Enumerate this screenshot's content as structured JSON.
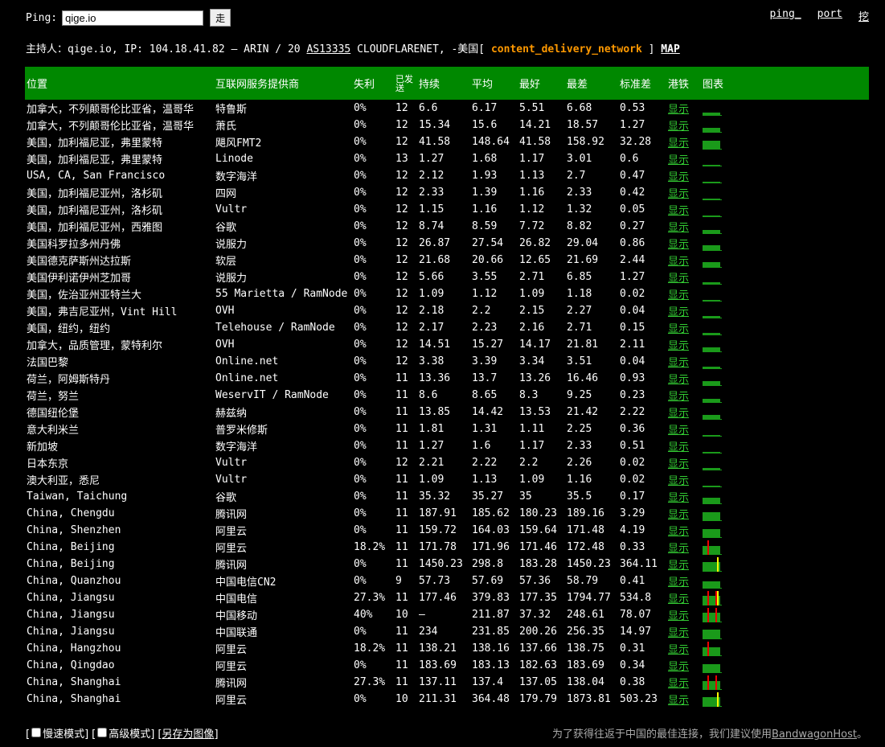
{
  "top": {
    "ping_label": "Ping:",
    "ping_value": "qige.io",
    "go_label": "走"
  },
  "links": {
    "ping": "ping_",
    "port": "port",
    "dig": "挖"
  },
  "host": {
    "prefix": "主持人：",
    "name": "qige.io",
    "ip_text": ", IP: 104.18.41.82 – ARIN / 20 ",
    "asn": "AS13335",
    "org": " CLOUDFLARENET, -美国[ ",
    "tag": "content_delivery_network",
    "close": " ]",
    "map": "MAP"
  },
  "columns": {
    "location": "位置",
    "isp": "互联网服务提供商",
    "loss": "失利",
    "sent": "已发送",
    "last": "持续",
    "avg": "平均",
    "best": "最好",
    "worst": "最差",
    "stdev": "标准差",
    "trace": "港铁",
    "graph": "图表"
  },
  "show_label": "显示",
  "rows": [
    {
      "location": "加拿大，不列颠哥伦比亚省，温哥华",
      "isp": "特鲁斯",
      "loss": "0%",
      "sent": "12",
      "last": "6.6",
      "avg": "6.17",
      "best": "5.51",
      "worst": "6.68",
      "stdev": "0.53"
    },
    {
      "location": "加拿大，不列颠哥伦比亚省，温哥华",
      "isp": "萧氏",
      "loss": "0%",
      "sent": "12",
      "last": "15.34",
      "avg": "15.6",
      "best": "14.21",
      "worst": "18.57",
      "stdev": "1.27"
    },
    {
      "location": "美国，加利福尼亚，弗里蒙特",
      "isp": "飓风FMT2",
      "loss": "0%",
      "sent": "12",
      "last": "41.58",
      "avg": "148.64",
      "best": "41.58",
      "worst": "158.92",
      "stdev": "32.28"
    },
    {
      "location": "美国，加利福尼亚，弗里蒙特",
      "isp": "Linode",
      "loss": "0%",
      "sent": "13",
      "last": "1.27",
      "avg": "1.68",
      "best": "1.17",
      "worst": "3.01",
      "stdev": "0.6"
    },
    {
      "location": "USA, CA, San Francisco",
      "isp": "数字海洋",
      "loss": "0%",
      "sent": "12",
      "last": "2.12",
      "avg": "1.93",
      "best": "1.13",
      "worst": "2.7",
      "stdev": "0.47"
    },
    {
      "location": "美国，加利福尼亚州，洛杉矶",
      "isp": "四网",
      "loss": "0%",
      "sent": "12",
      "last": "2.33",
      "avg": "1.39",
      "best": "1.16",
      "worst": "2.33",
      "stdev": "0.42"
    },
    {
      "location": "美国，加利福尼亚州，洛杉矶",
      "isp": "Vultr",
      "loss": "0%",
      "sent": "12",
      "last": "1.15",
      "avg": "1.16",
      "best": "1.12",
      "worst": "1.32",
      "stdev": "0.05"
    },
    {
      "location": "美国，加利福尼亚州，西雅图",
      "isp": "谷歌",
      "loss": "0%",
      "sent": "12",
      "last": "8.74",
      "avg": "8.59",
      "best": "7.72",
      "worst": "8.82",
      "stdev": "0.27"
    },
    {
      "location": "美国科罗拉多州丹佛",
      "isp": "说服力",
      "loss": "0%",
      "sent": "12",
      "last": "26.87",
      "avg": "27.54",
      "best": "26.82",
      "worst": "29.04",
      "stdev": "0.86"
    },
    {
      "location": "美国德克萨斯州达拉斯",
      "isp": "软层",
      "loss": "0%",
      "sent": "12",
      "last": "21.68",
      "avg": "20.66",
      "best": "12.65",
      "worst": "21.69",
      "stdev": "2.44"
    },
    {
      "location": "美国伊利诺伊州芝加哥",
      "isp": "说服力",
      "loss": "0%",
      "sent": "12",
      "last": "5.66",
      "avg": "3.55",
      "best": "2.71",
      "worst": "6.85",
      "stdev": "1.27"
    },
    {
      "location": "美国，佐治亚州亚特兰大",
      "isp": "55 Marietta / RamNode",
      "loss": "0%",
      "sent": "12",
      "last": "1.09",
      "avg": "1.12",
      "best": "1.09",
      "worst": "1.18",
      "stdev": "0.02"
    },
    {
      "location": "美国，弗吉尼亚州，Vint Hill",
      "isp": "OVH",
      "loss": "0%",
      "sent": "12",
      "last": "2.18",
      "avg": "2.2",
      "best": "2.15",
      "worst": "2.27",
      "stdev": "0.04"
    },
    {
      "location": "美国，纽约，纽约",
      "isp": "Telehouse / RamNode",
      "loss": "0%",
      "sent": "12",
      "last": "2.17",
      "avg": "2.23",
      "best": "2.16",
      "worst": "2.71",
      "stdev": "0.15"
    },
    {
      "location": "加拿大，品质管理，蒙特利尔",
      "isp": "OVH",
      "loss": "0%",
      "sent": "12",
      "last": "14.51",
      "avg": "15.27",
      "best": "14.17",
      "worst": "21.81",
      "stdev": "2.11"
    },
    {
      "location": "法国巴黎",
      "isp": "Online.net",
      "loss": "0%",
      "sent": "12",
      "last": "3.38",
      "avg": "3.39",
      "best": "3.34",
      "worst": "3.51",
      "stdev": "0.04"
    },
    {
      "location": "荷兰，阿姆斯特丹",
      "isp": "Online.net",
      "loss": "0%",
      "sent": "11",
      "last": "13.36",
      "avg": "13.7",
      "best": "13.26",
      "worst": "16.46",
      "stdev": "0.93"
    },
    {
      "location": "荷兰，努兰",
      "isp": "WeservIT / RamNode",
      "loss": "0%",
      "sent": "11",
      "last": "8.6",
      "avg": "8.65",
      "best": "8.3",
      "worst": "9.25",
      "stdev": "0.23"
    },
    {
      "location": "德国纽伦堡",
      "isp": "赫兹纳",
      "loss": "0%",
      "sent": "11",
      "last": "13.85",
      "avg": "14.42",
      "best": "13.53",
      "worst": "21.42",
      "stdev": "2.22"
    },
    {
      "location": "意大利米兰",
      "isp": "普罗米修斯",
      "loss": "0%",
      "sent": "11",
      "last": "1.81",
      "avg": "1.31",
      "best": "1.11",
      "worst": "2.25",
      "stdev": "0.36"
    },
    {
      "location": "新加坡",
      "isp": "数字海洋",
      "loss": "0%",
      "sent": "11",
      "last": "1.27",
      "avg": "1.6",
      "best": "1.17",
      "worst": "2.33",
      "stdev": "0.51"
    },
    {
      "location": "日本东京",
      "isp": "Vultr",
      "loss": "0%",
      "sent": "12",
      "last": "2.21",
      "avg": "2.22",
      "best": "2.2",
      "worst": "2.26",
      "stdev": "0.02"
    },
    {
      "location": "澳大利亚，悉尼",
      "isp": "Vultr",
      "loss": "0%",
      "sent": "11",
      "last": "1.09",
      "avg": "1.13",
      "best": "1.09",
      "worst": "1.16",
      "stdev": "0.02"
    },
    {
      "location": "Taiwan, Taichung",
      "isp": "谷歌",
      "loss": "0%",
      "sent": "11",
      "last": "35.32",
      "avg": "35.27",
      "best": "35",
      "worst": "35.5",
      "stdev": "0.17"
    },
    {
      "location": "China, Chengdu",
      "isp": "腾讯网",
      "loss": "0%",
      "sent": "11",
      "last": "187.91",
      "avg": "185.62",
      "best": "180.23",
      "worst": "189.16",
      "stdev": "3.29"
    },
    {
      "location": "China, Shenzhen",
      "isp": "阿里云",
      "loss": "0%",
      "sent": "11",
      "last": "159.72",
      "avg": "164.03",
      "best": "159.64",
      "worst": "171.48",
      "stdev": "4.19"
    },
    {
      "location": "China, Beijing",
      "isp": "阿里云",
      "loss": "18.2%",
      "sent": "11",
      "last": "171.78",
      "avg": "171.96",
      "best": "171.46",
      "worst": "172.48",
      "stdev": "0.33"
    },
    {
      "location": "China, Beijing",
      "isp": "腾讯网",
      "loss": "0%",
      "sent": "11",
      "last": "1450.23",
      "avg": "298.8",
      "best": "183.28",
      "worst": "1450.23",
      "stdev": "364.11"
    },
    {
      "location": "China, Quanzhou",
      "isp": "中国电信CN2",
      "loss": "0%",
      "sent": "9",
      "last": "57.73",
      "avg": "57.69",
      "best": "57.36",
      "worst": "58.79",
      "stdev": "0.41"
    },
    {
      "location": "China, Jiangsu",
      "isp": "中国电信",
      "loss": "27.3%",
      "sent": "11",
      "last": "177.46",
      "avg": "379.83",
      "best": "177.35",
      "worst": "1794.77",
      "stdev": "534.8"
    },
    {
      "location": "China, Jiangsu",
      "isp": "中国移动",
      "loss": "40%",
      "sent": "10",
      "last": "–",
      "avg": "211.87",
      "best": "37.32",
      "worst": "248.61",
      "stdev": "78.07"
    },
    {
      "location": "China, Jiangsu",
      "isp": "中国联通",
      "loss": "0%",
      "sent": "11",
      "last": "234",
      "avg": "231.85",
      "best": "200.26",
      "worst": "256.35",
      "stdev": "14.97"
    },
    {
      "location": "China, Hangzhou",
      "isp": "阿里云",
      "loss": "18.2%",
      "sent": "11",
      "last": "138.21",
      "avg": "138.16",
      "best": "137.66",
      "worst": "138.75",
      "stdev": "0.31"
    },
    {
      "location": "China, Qingdao",
      "isp": "阿里云",
      "loss": "0%",
      "sent": "11",
      "last": "183.69",
      "avg": "183.13",
      "best": "182.63",
      "worst": "183.69",
      "stdev": "0.34"
    },
    {
      "location": "China, Shanghai",
      "isp": "腾讯网",
      "loss": "27.3%",
      "sent": "11",
      "last": "137.11",
      "avg": "137.4",
      "best": "137.05",
      "worst": "138.04",
      "stdev": "0.38"
    },
    {
      "location": "China, Shanghai",
      "isp": "阿里云",
      "loss": "0%",
      "sent": "10",
      "last": "211.31",
      "avg": "364.48",
      "best": "179.79",
      "worst": "1873.81",
      "stdev": "503.23"
    }
  ],
  "footer": {
    "slow_mode": "慢速模式",
    "advanced_mode": "高级模式",
    "save_image": "另存为图像",
    "note": "为了获得往返于中国的最佳连接，我们建议使用",
    "note_link": "BandwagonHost",
    "note_end": "。"
  },
  "colors": {
    "header_bg": "#008800",
    "link_green": "#33cc33",
    "tag_orange": "#ff9900",
    "loss_red": "#ee0000"
  }
}
